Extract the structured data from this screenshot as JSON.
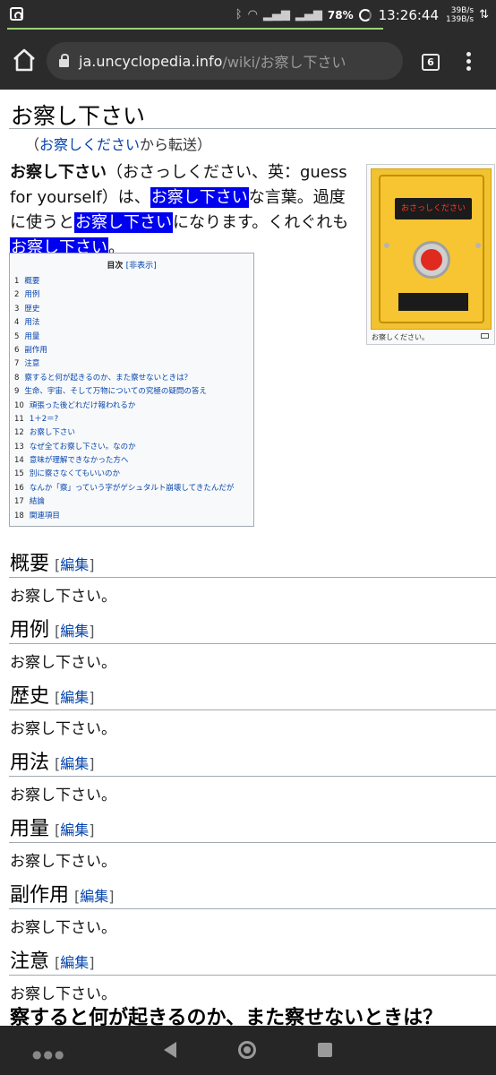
{
  "status_bar": {
    "battery": "78%",
    "time": "13:26:44",
    "speed_up": "39B/s",
    "speed_down": "139B/s",
    "icons": [
      "bluetooth-icon",
      "wifi-icon",
      "signal-icon",
      "signal-icon",
      "battery-icon"
    ]
  },
  "browser": {
    "url_host": "ja.uncyclopedia.info",
    "url_path": "/wiki/お察し下さい",
    "tab_count": "6"
  },
  "article": {
    "title": "お察し下さい",
    "redirect_open": "（",
    "redirect_link": "お察しください",
    "redirect_rest": "から転送）",
    "lead": {
      "bold": "お察し下さい",
      "p1": "（おさっしください、英：guess for yourself）は、",
      "hl1": "お察し下さい",
      "p2": "な言葉。過度に使うと",
      "hl2": "お察し下さい",
      "p3": "になります。くれぐれも",
      "hl3": "お察し下さい",
      "p4": "。"
    },
    "thumb": {
      "sign_text": "おさっしください",
      "caption": "お察しください。"
    },
    "toc": {
      "title": "目次",
      "toggle": "[非表示]",
      "items": [
        {
          "num": "1",
          "text": "概要"
        },
        {
          "num": "2",
          "text": "用例"
        },
        {
          "num": "3",
          "text": "歴史"
        },
        {
          "num": "4",
          "text": "用法"
        },
        {
          "num": "5",
          "text": "用量"
        },
        {
          "num": "6",
          "text": "副作用"
        },
        {
          "num": "7",
          "text": "注意"
        },
        {
          "num": "8",
          "text": "察すると何が起きるのか、また察せないときは？"
        },
        {
          "num": "9",
          "text": "生命、宇宙、そして万物についての究極の疑問の答え"
        },
        {
          "num": "10",
          "text": "頑張った後どれだけ報われるか"
        },
        {
          "num": "11",
          "text": "1＋2＝?"
        },
        {
          "num": "12",
          "text": "お察し下さい"
        },
        {
          "num": "13",
          "text": "なぜ全てお察し下さい。なのか"
        },
        {
          "num": "14",
          "text": "意味が理解できなかった方へ"
        },
        {
          "num": "15",
          "text": "別に察さなくてもいいのか"
        },
        {
          "num": "16",
          "text": "なんか「察」っていう字がゲシュタルト崩壊してきたんだが"
        },
        {
          "num": "17",
          "text": "結論"
        },
        {
          "num": "18",
          "text": "関連項目"
        }
      ]
    },
    "edit_open": "[",
    "edit_label": "編集",
    "edit_close": "]",
    "sections": [
      {
        "heading": "概要",
        "body": "お察し下さい。"
      },
      {
        "heading": "用例",
        "body": "お察し下さい。"
      },
      {
        "heading": "歴史",
        "body": "お察し下さい。"
      },
      {
        "heading": "用法",
        "body": "お察し下さい。"
      },
      {
        "heading": "用量",
        "body": "お察し下さい。"
      },
      {
        "heading": "副作用",
        "body": "お察し下さい。"
      },
      {
        "heading": "注意",
        "body": "お察し下さい。"
      }
    ],
    "next_heading": "察すると何が起きるのか、また察せないときは？"
  },
  "navbar": {
    "icons": [
      "more-icon",
      "back-icon",
      "home-icon",
      "recents-icon"
    ]
  }
}
